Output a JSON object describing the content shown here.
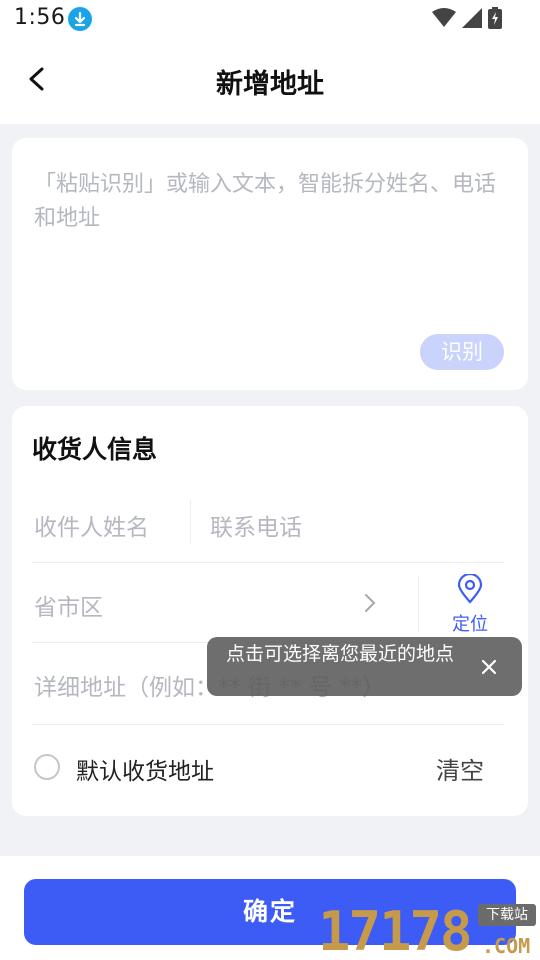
{
  "status_bar": {
    "time": "1:56",
    "icons": [
      "download-icon",
      "wifi-icon",
      "signal-icon",
      "battery-icon"
    ]
  },
  "nav": {
    "title": "新增地址",
    "back_icon": "back-arrow-icon"
  },
  "paste_area": {
    "placeholder": "「粘贴识别」或输入文本，智能拆分姓名、电话和地址",
    "recognize_label": "识别"
  },
  "receiver_info": {
    "section_title": "收货人信息",
    "name_placeholder": "收件人姓名",
    "phone_placeholder": "联系电话",
    "region_placeholder": "省市区",
    "locate_label": "定位",
    "detail_placeholder": "详细地址（例如：** 街 ** 号 **）",
    "default_label": "默认收货地址",
    "clear_label": "清空"
  },
  "tooltip": {
    "text": "点击可选择离您最近的地点"
  },
  "footer": {
    "confirm_label": "确定"
  },
  "watermark": {
    "numbers": "17178",
    "tag": "下载站",
    "suffix": ".COM"
  },
  "colors": {
    "accent": "#3d5cf5",
    "accent_light": "#c9d3fb",
    "placeholder": "#b5b8c0",
    "background": "#f0f2f6"
  }
}
